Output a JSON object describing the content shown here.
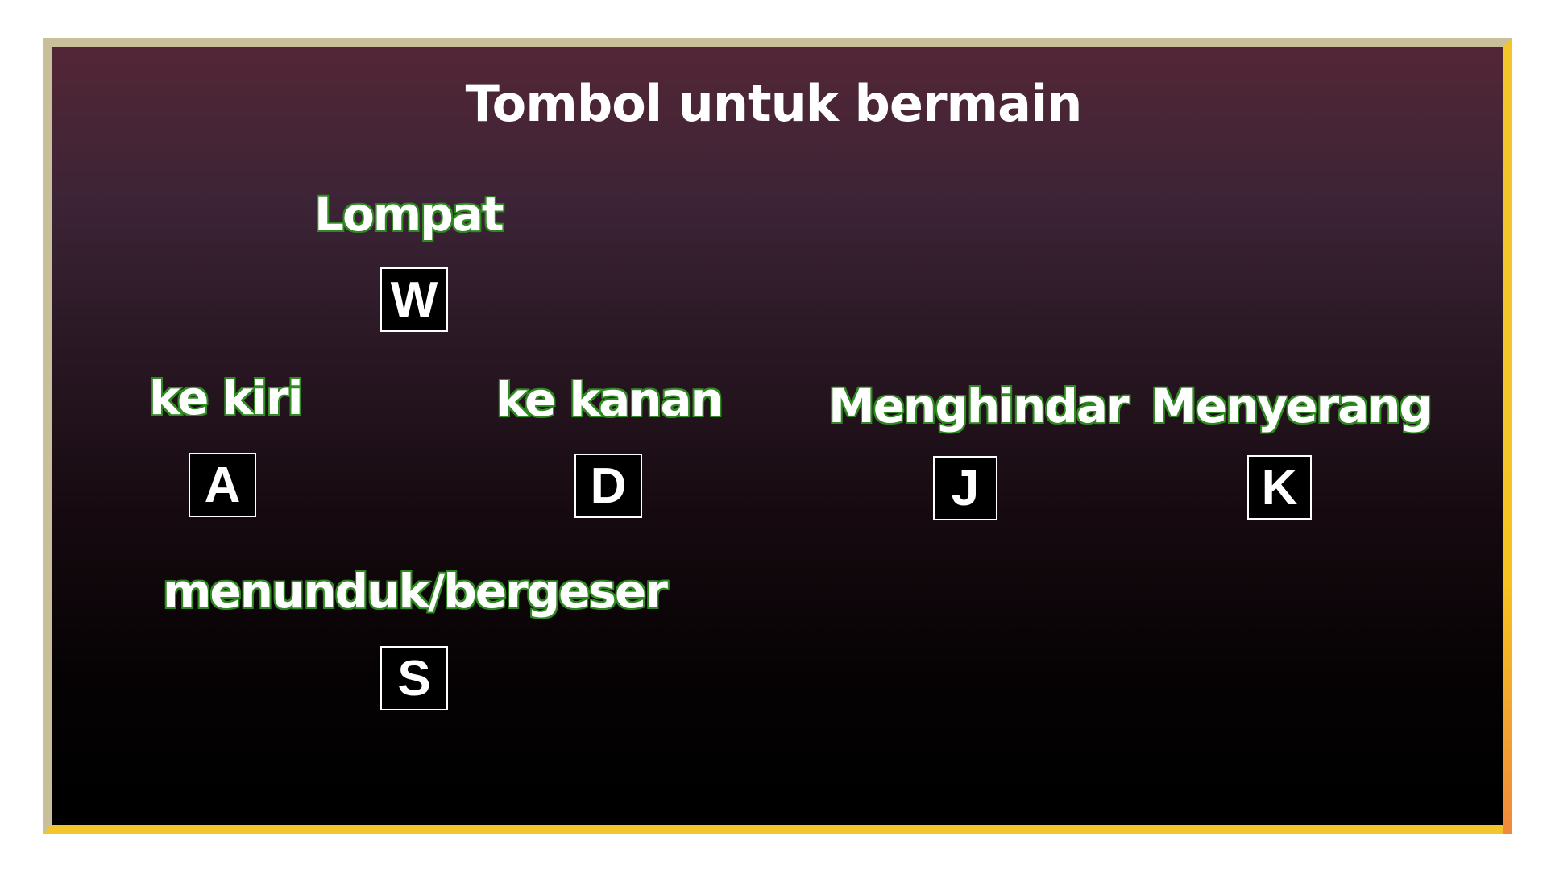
{
  "title": "Tombol untuk bermain",
  "controls": {
    "jump": {
      "label": "Lompat",
      "key": "W"
    },
    "left": {
      "label": "ke kiri",
      "key": "A"
    },
    "right": {
      "label": "ke kanan",
      "key": "D"
    },
    "dodge": {
      "label": "Menghindar",
      "key": "J"
    },
    "attack": {
      "label": "Menyerang",
      "key": "K"
    },
    "crouch": {
      "label": "menunduk/bergeser",
      "key": "S"
    }
  },
  "colors": {
    "label_outline": "#3a9a2c",
    "frame_border": "#c9bf9a",
    "frame_border_accent": "#f2c62a",
    "background_top": "#532636",
    "background_bottom": "#000000"
  }
}
